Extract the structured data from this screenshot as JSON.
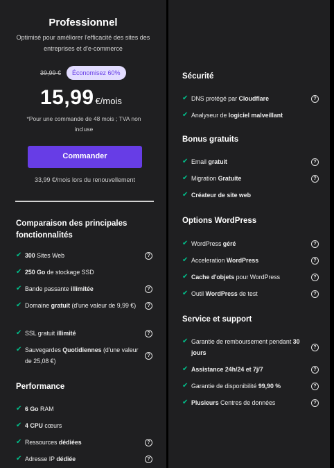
{
  "plan": {
    "title": "Professionnel",
    "description": "Optimisé pour améliorer l'efficacité des sites des entreprises et d'e-commerce",
    "old_price": "39,99 €",
    "save_badge": "Économisez 60%",
    "price": "15,99",
    "price_unit": "€/mois",
    "price_note": "*Pour une commande de 48 mois ; TVA non incluse",
    "order_button": "Commander",
    "renewal": "33,99 €/mois lors du renouvellement"
  },
  "comparison": {
    "title": "Comparaison des principales fonctionnalités",
    "items": [
      {
        "bold": "300",
        "text": " Sites Web"
      },
      {
        "bold": "250 Go",
        "text": " de stockage SSD"
      },
      {
        "text": "Bande passante ",
        "bold": "illimitée"
      },
      {
        "text": "Domaine ",
        "bold": "gratuit",
        "rest": " (d'une valeur de 9,99 €)"
      },
      {
        "text": "SSL gratuit ",
        "bold": "illimité"
      },
      {
        "text": "Sauvegardes ",
        "bold": "Quotidiennes",
        "rest": " (d'une valeur de 25,08 €)"
      }
    ]
  },
  "performance": {
    "title": "Performance",
    "items": [
      {
        "bold": "6 Go",
        "text": " RAM"
      },
      {
        "bold": "4 CPU",
        "text": " cœurs"
      },
      {
        "text": "Ressources ",
        "bold": "dédiées"
      },
      {
        "text": "Adresse IP ",
        "bold": "dédiée"
      }
    ]
  },
  "security": {
    "title": "Sécurité",
    "items": [
      {
        "text": "DNS protégé par ",
        "bold": "Cloudflare"
      },
      {
        "text": "Analyseur de ",
        "bold": "logiciel malveillant"
      }
    ]
  },
  "bonus": {
    "title": "Bonus gratuits",
    "items": [
      {
        "text": "Email ",
        "bold": "gratuit"
      },
      {
        "text": "Migration ",
        "bold": "Gratuite"
      },
      {
        "bold": "Créateur de site web"
      }
    ]
  },
  "wordpress": {
    "title": "Options WordPress",
    "items": [
      {
        "text": "WordPress ",
        "bold": "géré"
      },
      {
        "text": "Acceleration ",
        "bold": "WordPress"
      },
      {
        "bold": "Cache d'objets",
        "text": " pour WordPress"
      },
      {
        "text": "Outil ",
        "bold": "WordPress",
        "rest": " de test"
      }
    ]
  },
  "support": {
    "title": "Service et support",
    "items": [
      {
        "text": "Garantie de remboursement pendant ",
        "bold": "30 jours"
      },
      {
        "bold": "Assistance 24h/24 et 7j/7"
      },
      {
        "text": "Garantie de disponibilité ",
        "bold": "99,90 %"
      },
      {
        "bold": "Plusieurs",
        "text": " Centres de données"
      }
    ]
  },
  "icons": {
    "check": "check-icon",
    "info": "question-circle-icon"
  },
  "colors": {
    "accent": "#673de6",
    "check": "#00c08b",
    "badge_bg": "#e2dcff",
    "panel": "#1f1f21"
  }
}
